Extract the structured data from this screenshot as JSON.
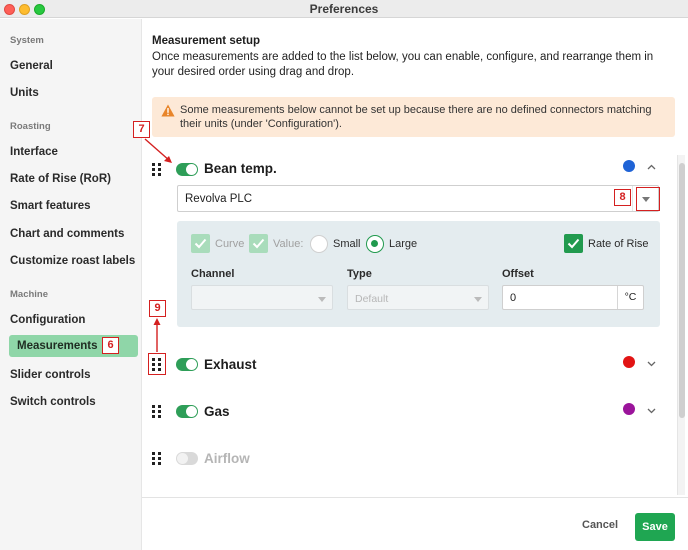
{
  "window": {
    "title": "Preferences"
  },
  "sidebar": {
    "sections": [
      {
        "label": "System",
        "items": [
          "General",
          "Units"
        ]
      },
      {
        "label": "Roasting",
        "items": [
          "Interface",
          "Rate of Rise (RoR)",
          "Smart features",
          "Chart and comments",
          "Customize roast labels"
        ]
      },
      {
        "label": "Machine",
        "items": [
          "Configuration",
          "Measurements",
          "Slider controls",
          "Switch controls"
        ]
      }
    ],
    "active_item": "Measurements"
  },
  "main": {
    "heading": "Measurement setup",
    "description": "Once measurements are added to the list below, you can enable, configure, and rearrange them in your desired order using drag and drop.",
    "warning": "Some measurements below cannot be set up because there are no defined connectors matching their units (under 'Configuration')."
  },
  "measurements": [
    {
      "name": "Bean temp.",
      "enabled": true,
      "color": "#1f63d6",
      "expanded": true
    },
    {
      "name": "Exhaust",
      "enabled": true,
      "color": "#e21414",
      "expanded": false
    },
    {
      "name": "Gas",
      "enabled": true,
      "color": "#9b149b",
      "expanded": false
    },
    {
      "name": "Airflow",
      "enabled": false,
      "color": "",
      "expanded": false
    }
  ],
  "bean_temp_config": {
    "connector": "Revolva PLC",
    "options": {
      "curve_label": "Curve",
      "value_label": "Value:",
      "small_label": "Small",
      "large_label": "Large",
      "ror_label": "Rate of Rise",
      "selected_size": "Large"
    },
    "channel": {
      "label": "Channel",
      "value": ""
    },
    "type": {
      "label": "Type",
      "placeholder": "Default"
    },
    "offset": {
      "label": "Offset",
      "value": "0",
      "unit": "°C"
    }
  },
  "annotations": {
    "a6": "6",
    "a7": "7",
    "a8": "8",
    "a9": "9"
  },
  "footer": {
    "cancel_label": "Cancel",
    "save_label": "Save"
  },
  "icons": {
    "warning": "warning-triangle-icon",
    "drag": "drag-handle-icon",
    "check": "checkmark-icon"
  }
}
